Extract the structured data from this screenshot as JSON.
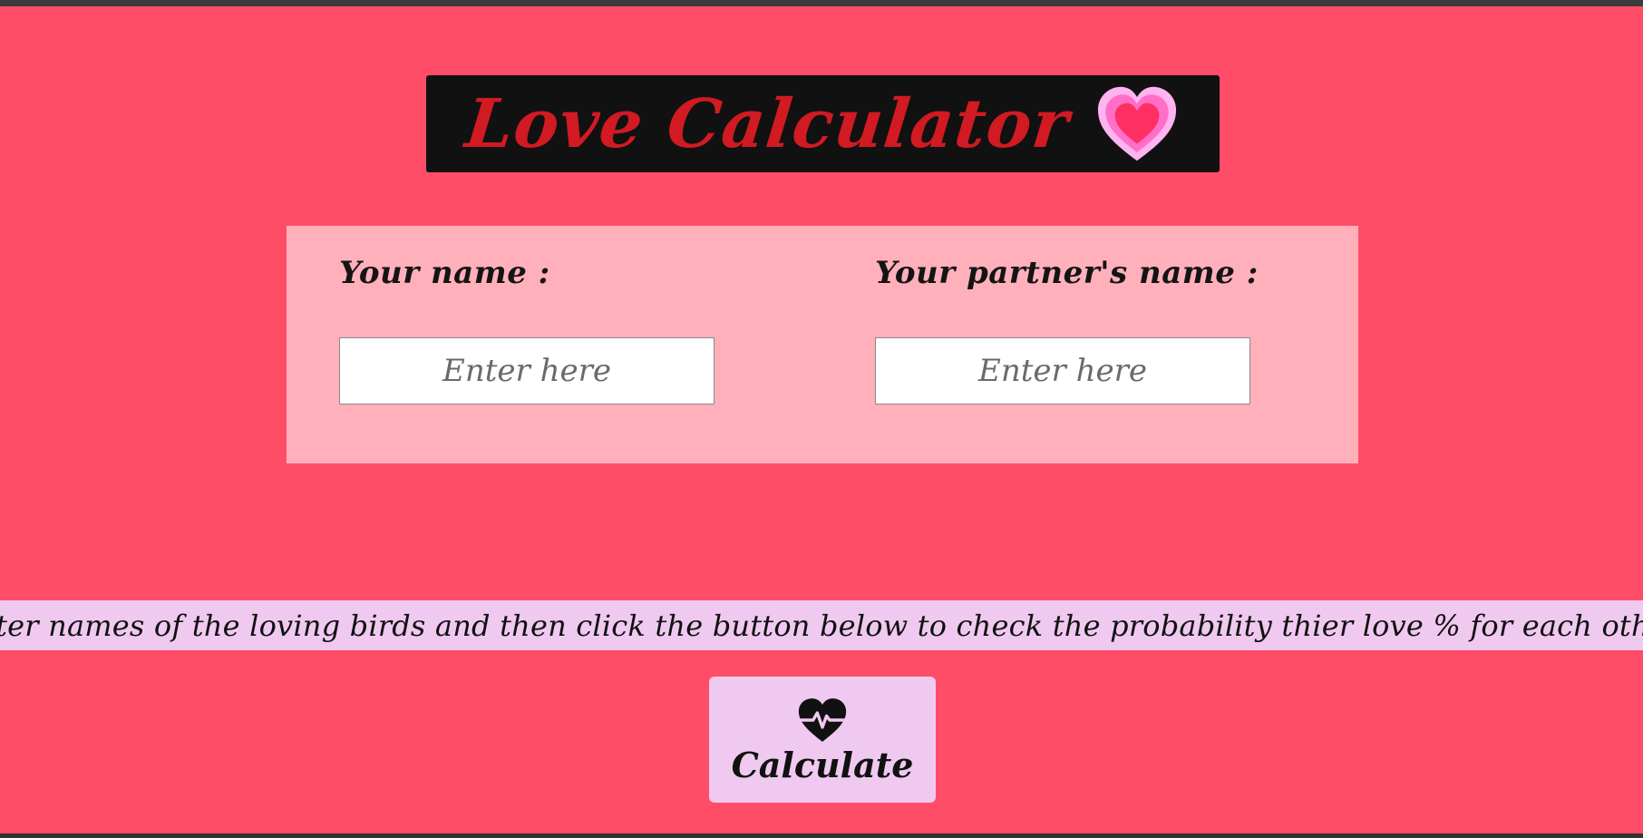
{
  "header": {
    "title": "Love Calculator",
    "title_icon": "pink-heart-icon"
  },
  "form": {
    "your_name_label": "Your name :",
    "your_name_placeholder": "Enter here",
    "your_name_value": "",
    "partner_name_label": "Your partner's name :",
    "partner_name_placeholder": "Enter here",
    "partner_name_value": ""
  },
  "instructions": {
    "text": "Enter names of the loving birds and then click the button below to check the probability thier love % for each other."
  },
  "action": {
    "button_label": "Calculate",
    "button_icon": "heart-pulse-icon"
  },
  "colors": {
    "page_background": "#ff4d68",
    "title_banner": "#111111",
    "title_text": "#d11a22",
    "form_card": "#ffb0bb",
    "info_band": "#f0c9f0",
    "button_background": "#f0c9f0"
  }
}
